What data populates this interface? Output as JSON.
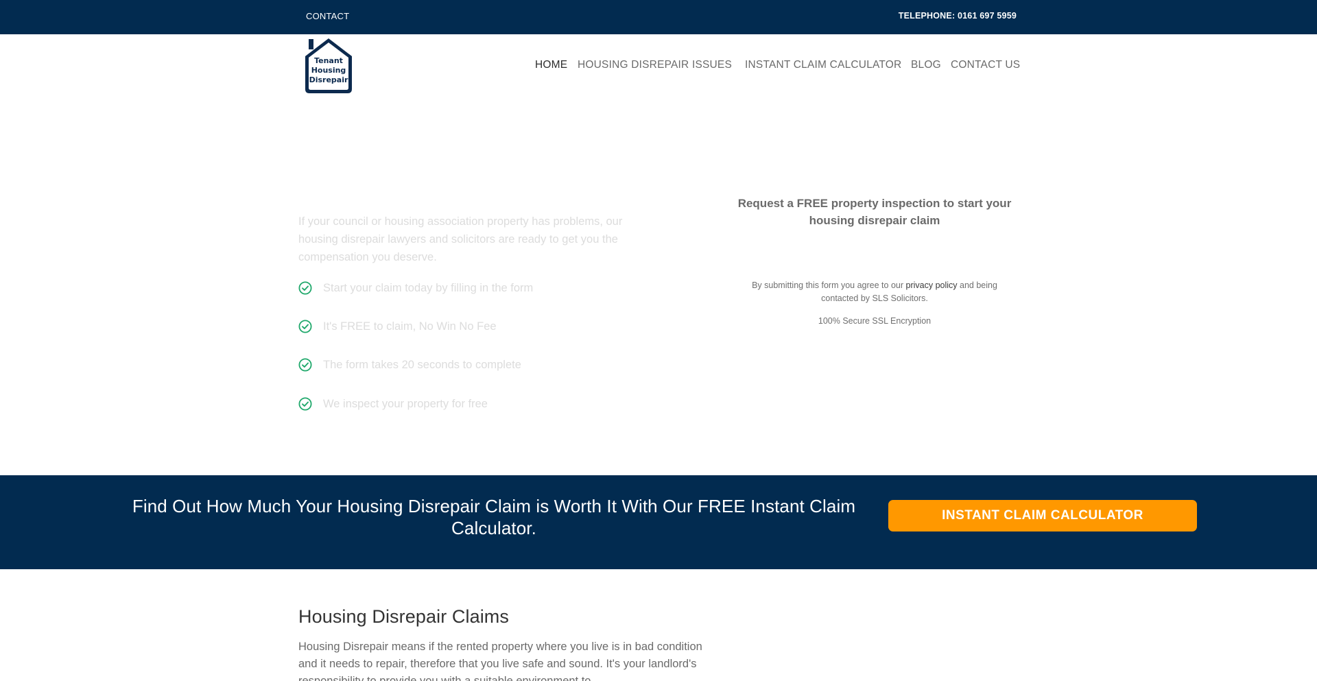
{
  "topbar": {
    "contact_label": "CONTACT",
    "telephone": "TELEPHONE: 0161 697 5959"
  },
  "logo": {
    "line1": "Tenant",
    "line2": "Housing",
    "line3": "Disrepair"
  },
  "nav": {
    "items": [
      {
        "label": "HOME"
      },
      {
        "label": "HOUSING DISREPAIR ISSUES"
      },
      {
        "label": "INSTANT CLAIM CALCULATOR"
      },
      {
        "label": "BLOG"
      },
      {
        "label": "CONTACT US"
      }
    ]
  },
  "hero": {
    "intro": "If your council or housing association property has problems, our housing disrepair lawyers and solicitors are ready to get you the compensation you deserve.",
    "bullets": [
      "Start your claim today by filling in the form",
      "It's FREE to claim, No Win No Fee",
      "The form takes 20 seconds to complete",
      "We inspect your property for free"
    ],
    "form_heading": "Request a FREE property inspection to start your housing disrepair claim",
    "consent_before": "By submitting this form you agree to our ",
    "consent_link": "privacy policy",
    "consent_after": " and being contacted by SLS Solicitors.",
    "ssl_note": "100% Secure SSL Encryption"
  },
  "cta": {
    "text": "Find Out How Much Your Housing Disrepair Claim is Worth It With Our FREE Instant Claim Calculator.",
    "button_label": "INSTANT CLAIM CALCULATOR"
  },
  "content": {
    "title": "Housing Disrepair Claims",
    "body": "Housing Disrepair means if the rented property where you live is in bad condition and it needs to repair, therefore that you live safe and sound. It's your landlord's responsibility to provide you with a suitable environment to"
  },
  "colors": {
    "navy": "#022b50",
    "orange": "#ff9800",
    "check_green": "#1fa86b"
  },
  "icons": {
    "bullet": "check-circle-icon",
    "logo": "house-icon"
  }
}
